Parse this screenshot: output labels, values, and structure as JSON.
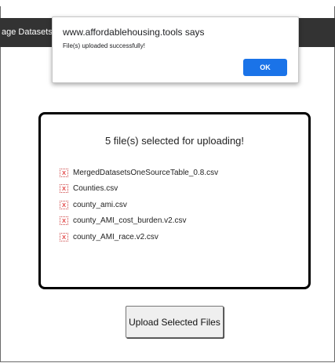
{
  "navbar": {
    "item_label": "age Datasets"
  },
  "alert_dialog": {
    "title": "www.affordablehousing.tools says",
    "message": "File(s) uploaded successfully!",
    "ok_label": "OK",
    "ok_color": "#1a73e8"
  },
  "upload_panel": {
    "heading": "5 file(s) selected for uploading!",
    "remove_icon": "close-icon",
    "files": [
      {
        "name": "MergedDatasetsOneSourceTable_0.8.csv",
        "remove_label": "x"
      },
      {
        "name": "Counties.csv",
        "remove_label": "x"
      },
      {
        "name": "county_ami.csv",
        "remove_label": "x"
      },
      {
        "name": "county_AMI_cost_burden.v2.csv",
        "remove_label": "x"
      },
      {
        "name": "county_AMI_race.v2.csv",
        "remove_label": "x"
      }
    ]
  },
  "upload_button": {
    "label": "Upload Selected Files"
  },
  "colors": {
    "navbar": "#333333",
    "box_border": "#000000",
    "remove_icon": "#dd2222"
  }
}
